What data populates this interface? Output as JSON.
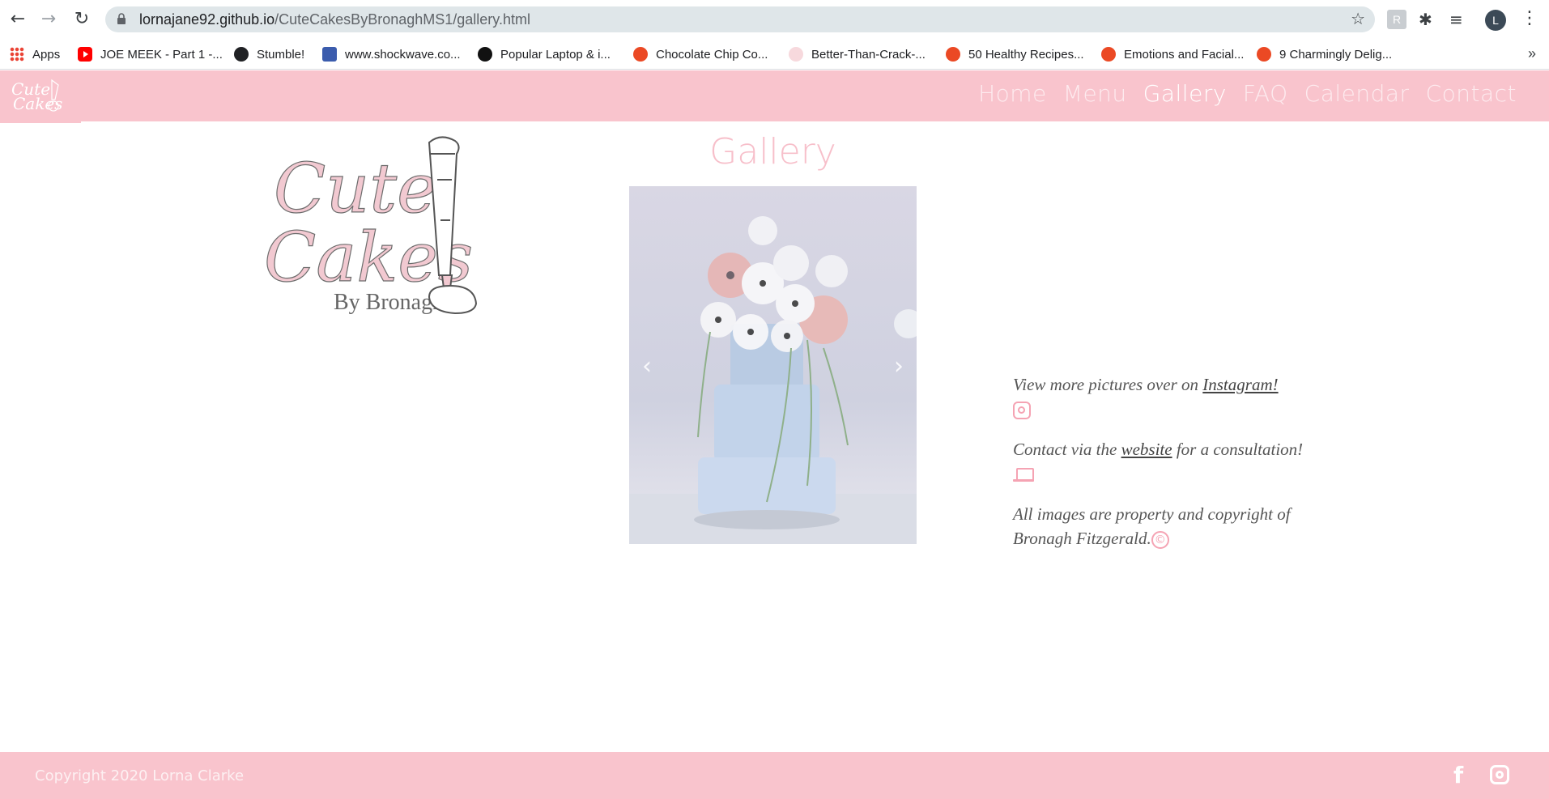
{
  "browser": {
    "url_host": "lornajane92.github.io",
    "url_path": "/CuteCakesByBronaghMS1/gallery.html",
    "profile_initial": "L",
    "bookmarks": [
      {
        "label": "Apps",
        "icon": "apps-grid-icon"
      },
      {
        "label": "JOE MEEK - Part 1 -...",
        "icon": "youtube-icon"
      },
      {
        "label": "Stumble!",
        "icon": "globe-icon"
      },
      {
        "label": "www.shockwave.co...",
        "icon": "shockwave-icon"
      },
      {
        "label": "Popular Laptop & i...",
        "icon": "sd-icon"
      },
      {
        "label": "Chocolate Chip Co...",
        "icon": "stumbleupon-icon"
      },
      {
        "label": "Better-Than-Crack-...",
        "icon": "heart-icon"
      },
      {
        "label": "50 Healthy Recipes...",
        "icon": "stumbleupon-icon"
      },
      {
        "label": "Emotions and Facial...",
        "icon": "stumbleupon-icon"
      },
      {
        "label": "9 Charmingly Delig...",
        "icon": "stumbleupon-icon"
      }
    ],
    "more": "»"
  },
  "site": {
    "nav": {
      "items": [
        {
          "label": "Home"
        },
        {
          "label": "Menu"
        },
        {
          "label": "Gallery",
          "active": true
        },
        {
          "label": "FAQ"
        },
        {
          "label": "Calendar"
        },
        {
          "label": "Contact"
        }
      ]
    },
    "logo_text": {
      "line1": "Cute",
      "line2": "Cakes",
      "line3": "By Bronagh"
    },
    "gallery_title": "Gallery",
    "carousel": {
      "prev": "‹",
      "next": "›"
    },
    "info": {
      "instagram_prefix": "View more pictures over on ",
      "instagram_link": "Instagram!",
      "contact_prefix": "Contact via the ",
      "contact_link": "website",
      "contact_suffix": " for a consultation!",
      "copyright_text": "All images are property and copyright of Bronagh Fitzgerald.",
      "copyright_symbol": "©"
    },
    "footer": {
      "copyright": "Copyright 2020 Lorna Clarke",
      "facebook_glyph": "f"
    }
  },
  "colors": {
    "brand_pink": "#f9c4cd",
    "accent_pink": "#f5a3b3"
  }
}
